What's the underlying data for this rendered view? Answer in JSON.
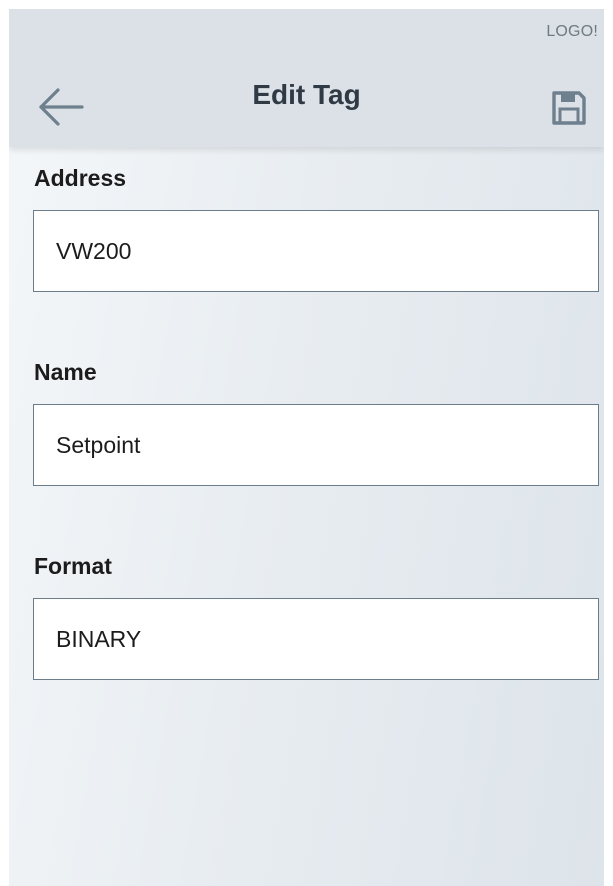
{
  "header": {
    "logo_text": "LOGO!",
    "title": "Edit Tag",
    "back_icon": "arrow-left-icon",
    "save_icon": "floppy-disk-icon"
  },
  "form": {
    "address": {
      "label": "Address",
      "value": "VW200"
    },
    "name": {
      "label": "Name",
      "value": "Setpoint"
    },
    "format": {
      "label": "Format",
      "value": "BINARY"
    }
  },
  "colors": {
    "header_bg": "#dbe1e6",
    "icon": "#6e7f8d",
    "title": "#2f3a44",
    "input_border": "#6b7c8a"
  }
}
